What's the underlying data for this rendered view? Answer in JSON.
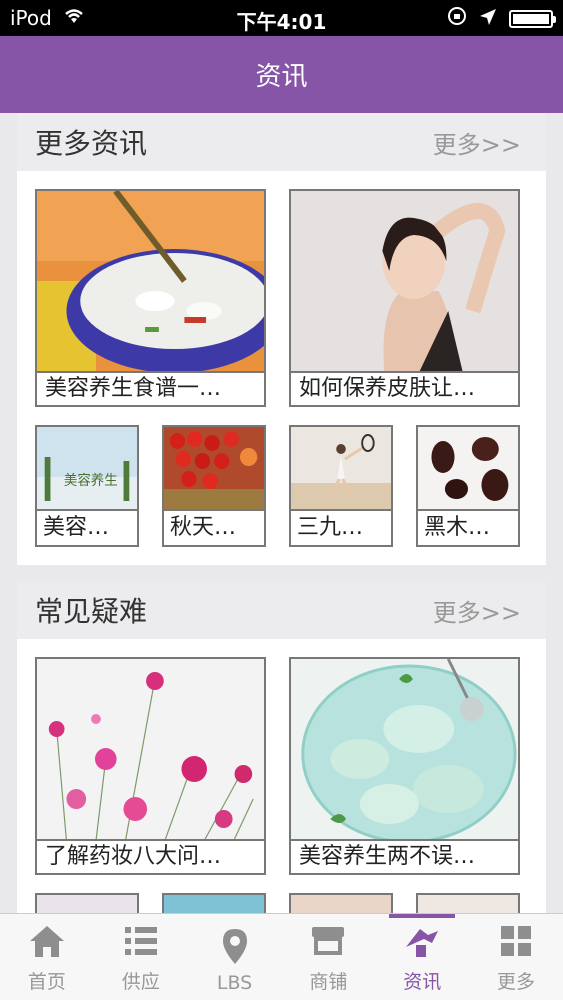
{
  "status_bar": {
    "carrier": "iPod",
    "time": "下午4:01"
  },
  "nav": {
    "title": "资讯"
  },
  "sections": [
    {
      "title": "更多资讯",
      "more": "更多>>",
      "big_cards": [
        {
          "caption": "美容养生食谱一…"
        },
        {
          "caption": "如何保养皮肤让…"
        }
      ],
      "small_cards": [
        {
          "caption": "美容…",
          "image_text": "美容养生"
        },
        {
          "caption": "秋天…"
        },
        {
          "caption": "三九…"
        },
        {
          "caption": "黑木…"
        }
      ]
    },
    {
      "title": "常见疑难",
      "more": "更多>>",
      "big_cards": [
        {
          "caption": "了解药妆八大问…"
        },
        {
          "caption": "美容养生两不误…"
        }
      ]
    }
  ],
  "tabbar": {
    "items": [
      {
        "label": "首页",
        "icon": "home-icon"
      },
      {
        "label": "供应",
        "icon": "list-icon"
      },
      {
        "label": "LBS",
        "icon": "location-pin-icon"
      },
      {
        "label": "商铺",
        "icon": "shop-icon"
      },
      {
        "label": "资讯",
        "icon": "news-icon",
        "active": true
      },
      {
        "label": "更多",
        "icon": "grid-icon"
      }
    ]
  },
  "colors": {
    "accent": "#8755a8",
    "statusbar": "#000000",
    "inactive_tab": "#999999"
  }
}
